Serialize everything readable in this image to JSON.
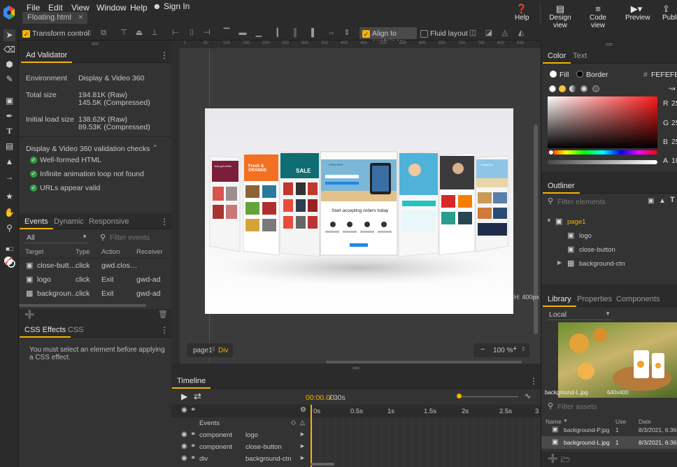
{
  "menubar": {
    "items": [
      "File",
      "Edit",
      "View",
      "Window",
      "Help"
    ],
    "sign_in": "Sign In",
    "document_tab": "Floating.html",
    "buttons": [
      {
        "label": "Help",
        "icon": "help-circle-icon"
      },
      {
        "label": "Design view",
        "icon": "design-view-icon"
      },
      {
        "label": "Code view",
        "icon": "code-view-icon"
      },
      {
        "label": "Preview",
        "icon": "preview-icon"
      },
      {
        "label": "Publi",
        "icon": "publish-icon"
      }
    ]
  },
  "toolbar": {
    "transform_control": "Transform control",
    "align_to_container": "Align to container",
    "fluid_layout": "Fluid layout"
  },
  "ad_validator": {
    "title": "Ad Validator",
    "rows": [
      {
        "label": "Environment",
        "value": "Display & Video 360",
        "value2": ""
      },
      {
        "label": "Total size",
        "value": "194.81K (Raw)",
        "value2": "145.5K (Compressed)"
      },
      {
        "label": "Initial load size",
        "value": "138.62K (Raw)",
        "value2": "89.53K (Compressed)"
      }
    ],
    "checks_title": "Display & Video 360 validation checks",
    "checks": [
      "Well-formed HTML",
      "Infinite animation loop not found",
      "URLs appear valid"
    ]
  },
  "events": {
    "tabs": [
      "Events",
      "Dynamic",
      "Responsive"
    ],
    "filter_select": "All",
    "filter_placeholder": "Filter events",
    "columns": [
      "Target",
      "Type",
      "Action",
      "Receiver"
    ],
    "rows": [
      {
        "target": "close-butt…",
        "type": "click",
        "action": "gwd.clos…",
        "receiver": ""
      },
      {
        "target": "logo",
        "type": "click",
        "action": "Exit",
        "receiver": "gwd-ad"
      },
      {
        "target": "backgroun…",
        "type": "click",
        "action": "Exit",
        "receiver": "gwd-ad"
      }
    ]
  },
  "css_effects": {
    "tabs": [
      "CSS Effects",
      "CSS"
    ],
    "message": "You must select an element before applying a CSS effect."
  },
  "stage": {
    "breadcrumb_page": "page1",
    "breadcrumb_element": "Div",
    "zoom": "100 %",
    "height_label": "H: 400px",
    "ruler_marks": [
      "0",
      "50",
      "100",
      "150",
      "200",
      "250",
      "300",
      "350",
      "400",
      "450",
      "500",
      "550",
      "600",
      "650",
      "700",
      "750",
      "800",
      "850"
    ],
    "canvas": {
      "headline": "Start accepting orders today",
      "headline_accent": "today",
      "brand": "PIXELREN",
      "card_text": [
        "Just got better",
        "Fresh & ORANGE",
        "SALE",
        "EasyPark"
      ]
    }
  },
  "timeline": {
    "title": "Timeline",
    "time": "00:00.00",
    "duration": "/ 30s",
    "ticks": [
      "0s",
      "0.5s",
      "1s",
      "1.5s",
      "2s",
      "2.5s",
      "3"
    ],
    "rows": [
      {
        "kind": "Events",
        "name": ""
      },
      {
        "kind": "component",
        "name": "logo"
      },
      {
        "kind": "component",
        "name": "close-button"
      },
      {
        "kind": "div",
        "name": "background-ctn"
      }
    ]
  },
  "color_panel": {
    "tabs": [
      "Color",
      "Text"
    ],
    "fill": "Fill",
    "border": "Border",
    "hex": "FEFEFE",
    "hash": "#",
    "channels": [
      {
        "name": "R",
        "value": "25"
      },
      {
        "name": "G",
        "value": "25"
      },
      {
        "name": "B",
        "value": "25"
      },
      {
        "name": "A",
        "value": "10"
      }
    ]
  },
  "outliner": {
    "title": "Outliner",
    "filter_placeholder": "Filter elements",
    "items": [
      {
        "label": "page1",
        "level": 0
      },
      {
        "label": "logo",
        "level": 1
      },
      {
        "label": "close-button",
        "level": 1
      },
      {
        "label": "background-ctn",
        "level": 1
      }
    ]
  },
  "library": {
    "tabs": [
      "Library",
      "Properties",
      "Components"
    ],
    "source": "Local",
    "preview_name": "background-L.jpg",
    "preview_size": "640x400",
    "filter_placeholder": "Filter assets",
    "columns": [
      "Name",
      "Use",
      "Date"
    ],
    "rows": [
      {
        "name": "background-P.jpg",
        "use": "1",
        "date": "8/3/2021, 6:36:0"
      },
      {
        "name": "background-L.jpg",
        "use": "1",
        "date": "8/3/2021, 6:36:0"
      }
    ]
  },
  "colors": {
    "accent": "#f4b400",
    "check": "#2ea043",
    "panel": "#333333",
    "bar": "#2b2b2b"
  }
}
